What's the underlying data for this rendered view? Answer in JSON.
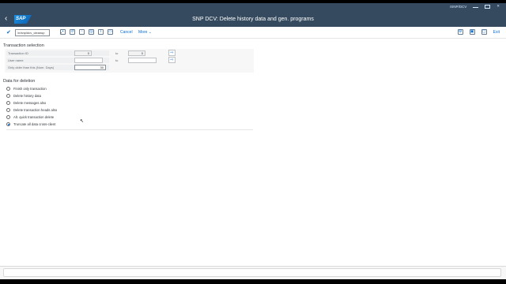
{
  "window": {
    "user_label": "rSNP/DCV",
    "title": "SNP DCV: Delete history data and gen. programs",
    "logo_text": "SAP"
  },
  "toolbar": {
    "command_value": "/n/snp/dcv_cleanup",
    "cancel_label": "Cancel",
    "more_label": "More",
    "exit_label": "Exit"
  },
  "selection": {
    "title": "Transaction selection",
    "rows": [
      {
        "label": "Transaction ID",
        "from": "0",
        "to_label": "to",
        "to": "0"
      },
      {
        "label": "User name",
        "from": "",
        "to_label": "to",
        "to": ""
      },
      {
        "label": "Only older than this (Num. Days)",
        "from": "30"
      }
    ]
  },
  "deletion": {
    "title": "Data for deletion",
    "options": [
      {
        "label": "Finish only transaction",
        "selected": false
      },
      {
        "label": "Delete history data",
        "selected": false
      },
      {
        "label": "Delete messages also",
        "selected": false
      },
      {
        "label": "Delete transaction heads also",
        "selected": false
      },
      {
        "label": "Alt. quick transaction delete",
        "selected": false
      },
      {
        "label": "Truncate all data cross-client",
        "selected": true
      }
    ]
  },
  "colors": {
    "shell": "#354a5f",
    "accent": "#0a6ed1"
  }
}
